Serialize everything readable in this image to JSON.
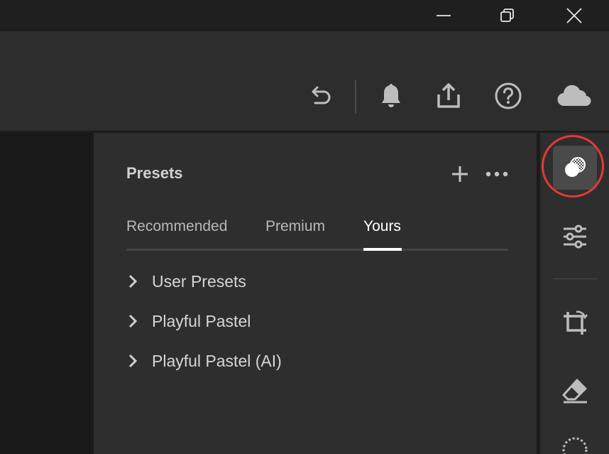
{
  "window": {
    "minimize_icon": "minimize-icon",
    "restore_icon": "restore-icon",
    "close_icon": "close-icon"
  },
  "toolbar": {
    "icons": [
      "undo-icon",
      "bell-icon",
      "share-icon",
      "help-icon",
      "cloud-icon"
    ]
  },
  "panel": {
    "title": "Presets",
    "tabs": [
      {
        "label": "Recommended",
        "active": false
      },
      {
        "label": "Premium",
        "active": false
      },
      {
        "label": "Yours",
        "active": true
      }
    ],
    "groups": [
      {
        "label": "User Presets"
      },
      {
        "label": "Playful Pastel"
      },
      {
        "label": "Playful Pastel (AI)"
      }
    ]
  },
  "rail": {
    "items": [
      "presets-icon",
      "edit-sliders-icon",
      "crop-icon",
      "eraser-icon",
      "mask-icon"
    ],
    "highlight_color": "#e53935"
  },
  "colors": {
    "background": "#1c1c1c",
    "panel": "#2e2e2e",
    "active_tab": "#ffffff"
  }
}
